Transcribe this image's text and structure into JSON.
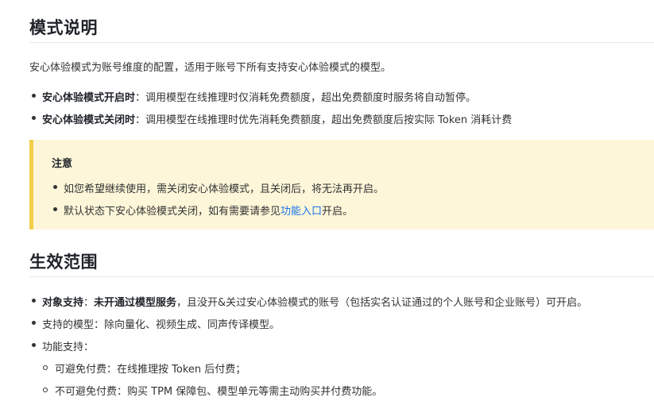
{
  "section1": {
    "title": "模式说明",
    "intro": "安心体验模式为账号维度的配置，适用于账号下所有支持安心体验模式的模型。",
    "items": [
      {
        "label": "安心体验模式开启时",
        "text": "：调用模型在线推理时仅消耗免费额度，超出免费额度时服务将自动暂停。"
      },
      {
        "label": "安心体验模式关闭时",
        "text": "：调用模型在线推理时优先消耗免费额度，超出免费额度后按实际 Token 消耗计费"
      }
    ]
  },
  "note": {
    "title": "注意",
    "item1": "如您希望继续使用，需关闭安心体验模式，且关闭后，将无法再开启。",
    "item2_before": "默认状态下安心体验模式关闭，如有需要请参见",
    "item2_link": "功能入口",
    "item2_after": "开启。"
  },
  "section2": {
    "title": "生效范围",
    "item1_label": "对象支持",
    "item1_colon": "：",
    "item1_bold": "未开通过模型服务",
    "item1_text": "，且没开&关过安心体验模式的账号（包括实名认证通过的个人账号和企业账号）可开启。",
    "item2": "支持的模型：除向量化、视频生成、同声传译模型。",
    "item3": "功能支持：",
    "sub1": "可避免付费：在线推理按 Token 后付费；",
    "sub2": "不可避免付费：购买 TPM 保障包、模型单元等需主动购买并付费功能。"
  }
}
